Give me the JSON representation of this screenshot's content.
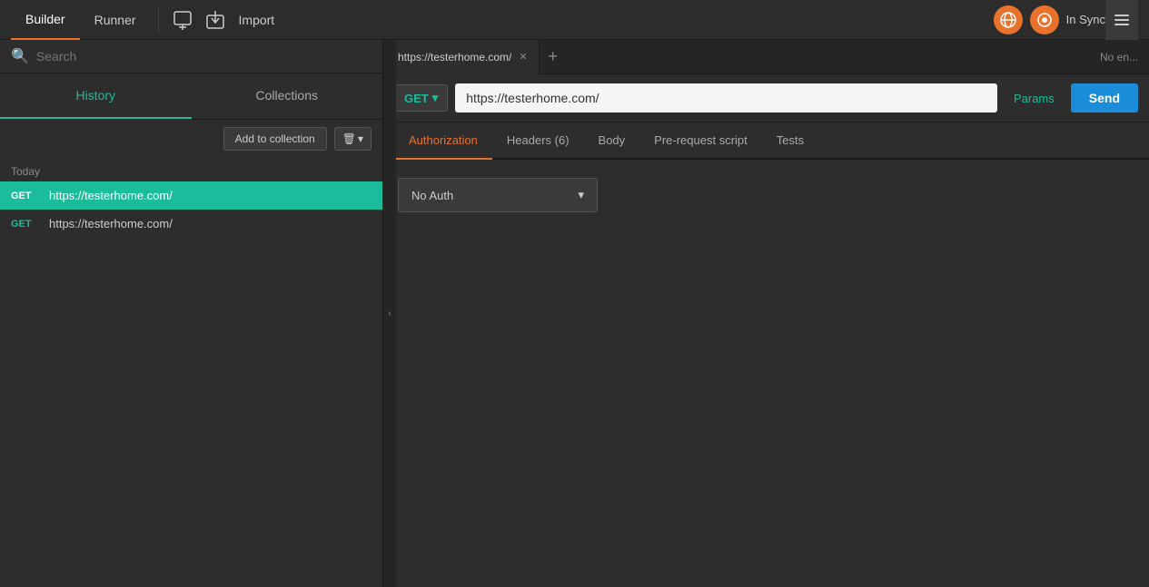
{
  "topnav": {
    "builder_label": "Builder",
    "runner_label": "Runner",
    "import_label": "Import",
    "sync_label": "In Sync",
    "new_tab_icon": "＋",
    "import_icon": "⬆"
  },
  "sidebar": {
    "search_placeholder": "Search",
    "history_label": "History",
    "collections_label": "Collections",
    "add_collection_label": "Add to collection",
    "today_label": "Today",
    "history_items": [
      {
        "method": "GET",
        "url": "https://testerhome.com/",
        "active": true
      },
      {
        "method": "GET",
        "url": "https://testerhome.com/",
        "active": false
      }
    ]
  },
  "request": {
    "tab_label": "https://testerhome.com/",
    "no_env_label": "No en...",
    "method": "GET",
    "url": "https://testerhome.com/",
    "params_label": "Params",
    "send_label": "Send",
    "tabs": [
      {
        "label": "Authorization",
        "active": true
      },
      {
        "label": "Headers (6)",
        "active": false
      },
      {
        "label": "Body",
        "active": false
      },
      {
        "label": "Pre-request script",
        "active": false
      },
      {
        "label": "Tests",
        "active": false
      }
    ],
    "auth_dropdown": {
      "value": "No Auth",
      "chevron": "▾"
    }
  }
}
